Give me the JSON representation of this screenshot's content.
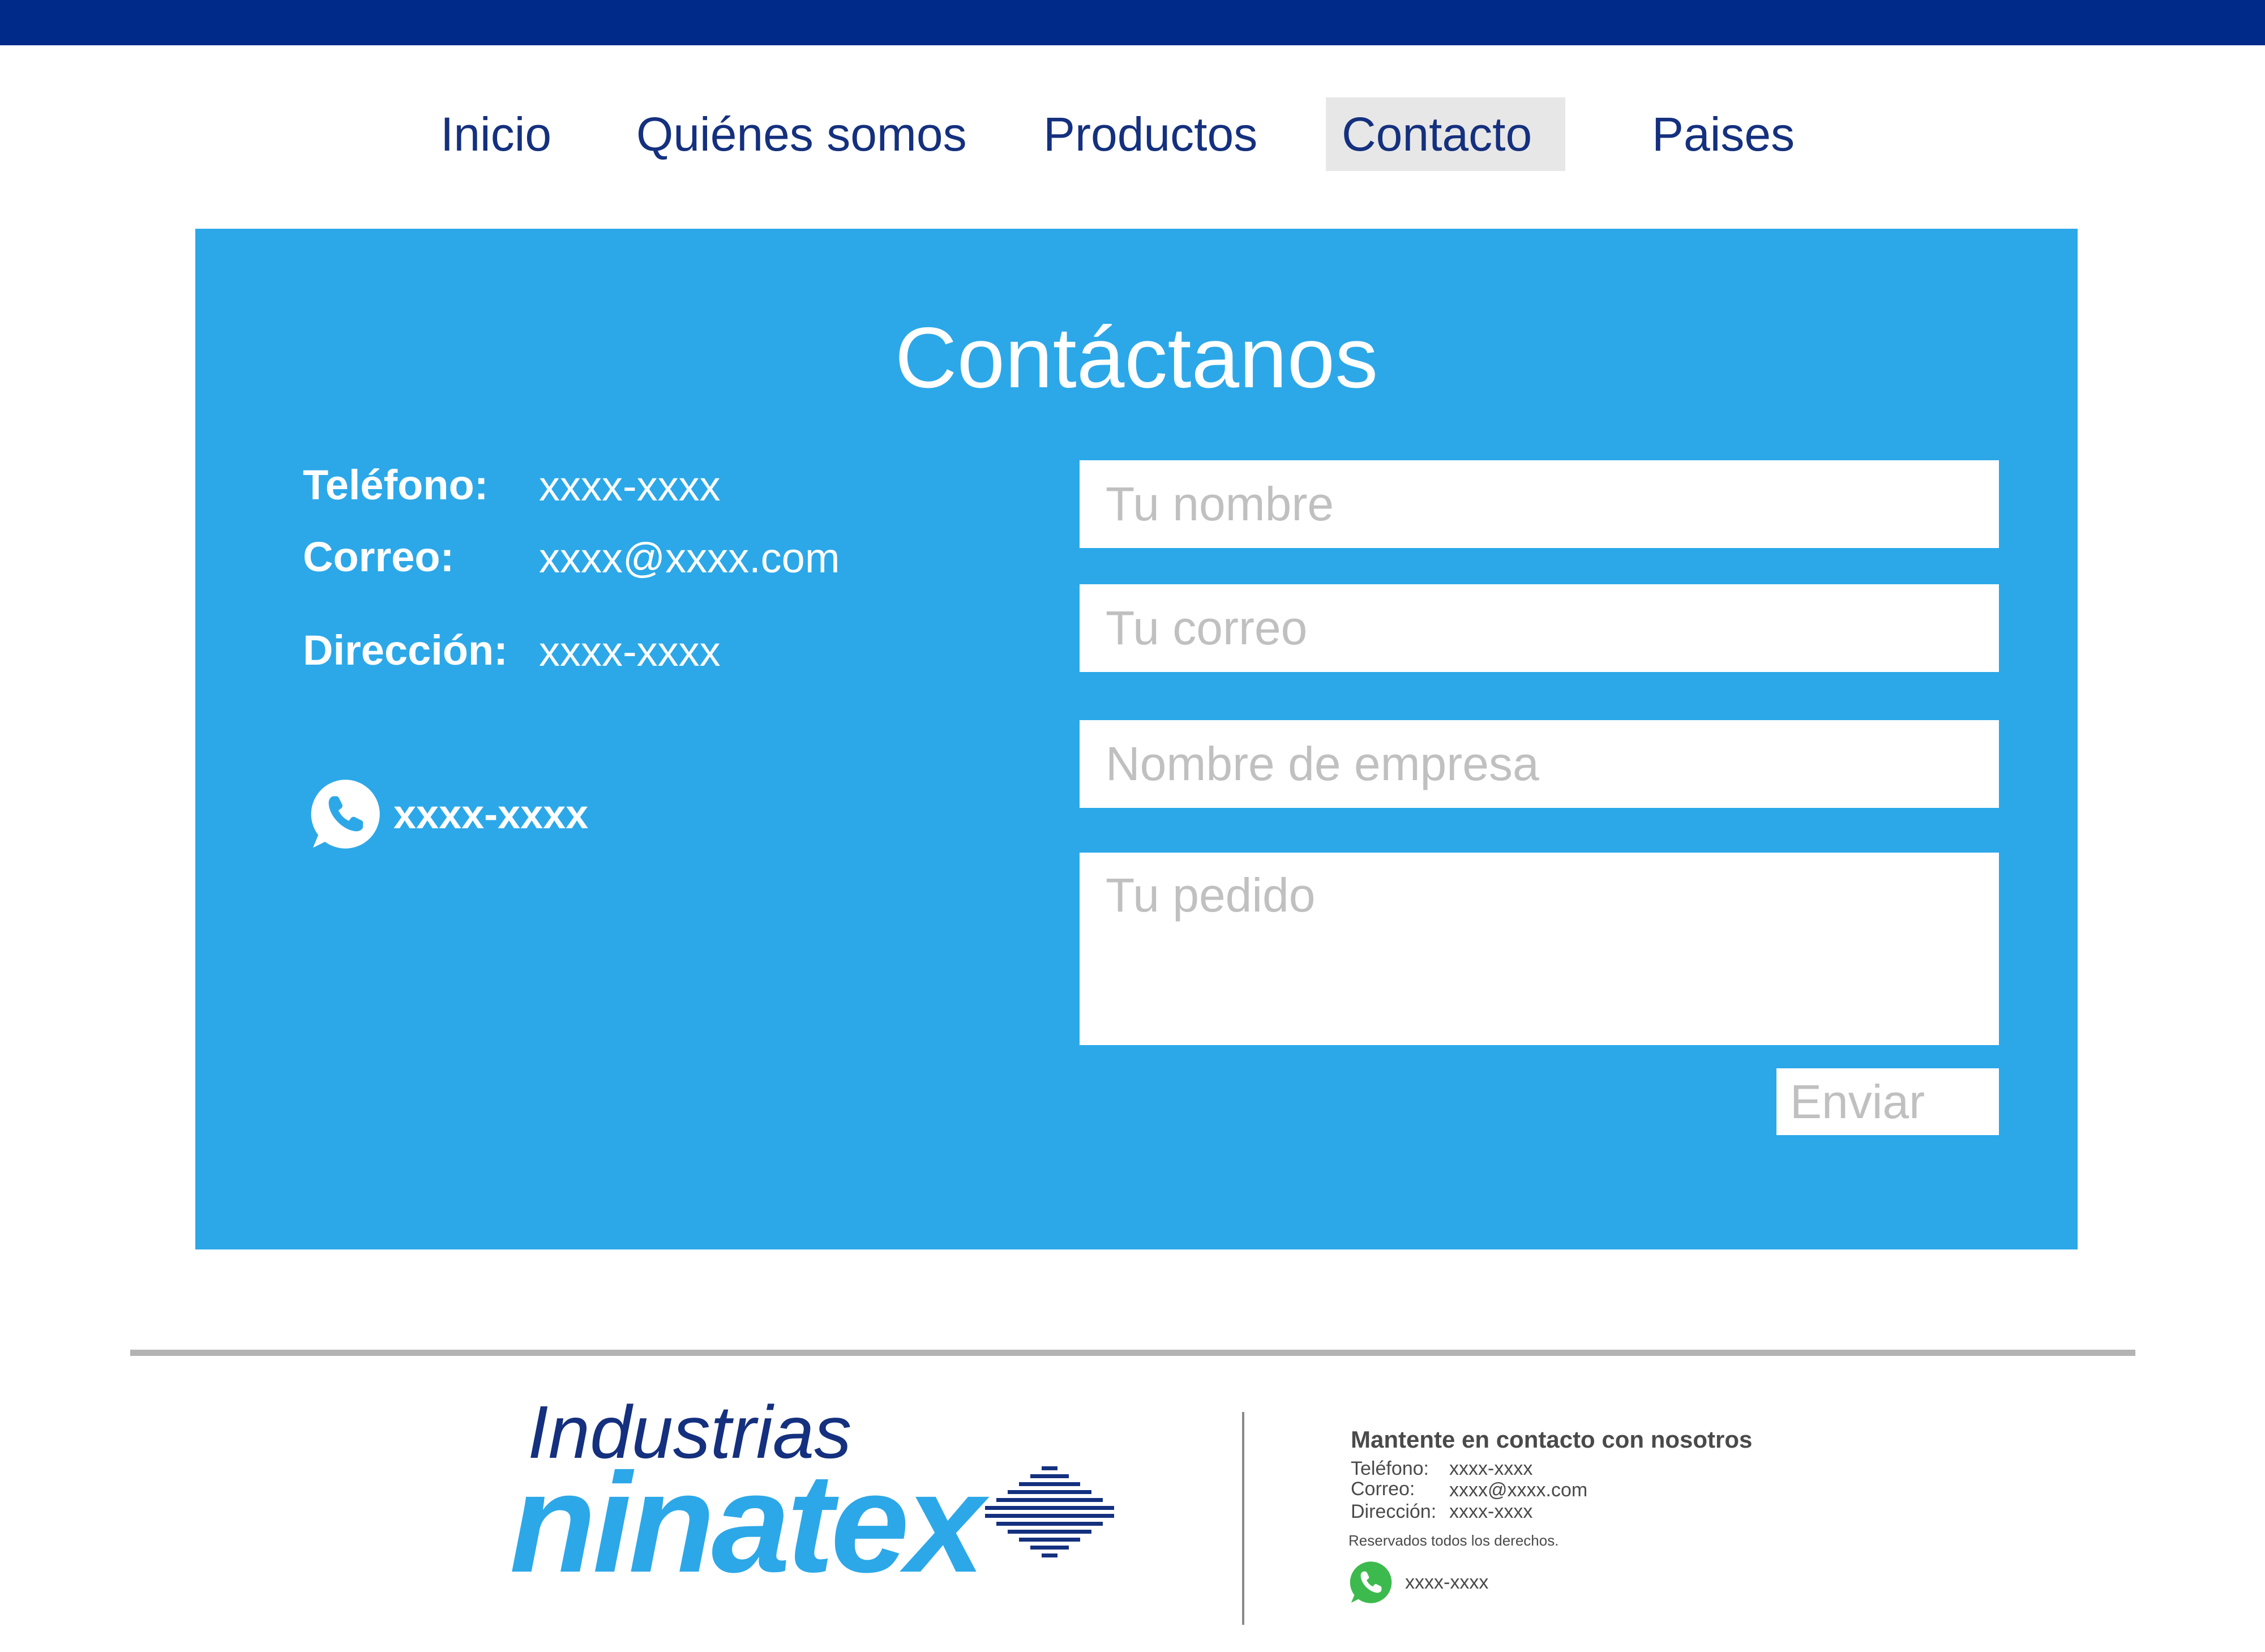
{
  "nav": {
    "items": [
      {
        "label": "Inicio"
      },
      {
        "label": "Quiénes somos"
      },
      {
        "label": "Productos"
      },
      {
        "label": "Contacto",
        "active": true
      },
      {
        "label": "Paises"
      }
    ]
  },
  "contact": {
    "title": "Contáctanos",
    "phone_label": "Teléfono:",
    "phone_value": "xxxx-xxxx",
    "email_label": "Correo:",
    "email_value": "xxxx@xxxx.com",
    "address_label": "Dirección:",
    "address_value": "xxxx-xxxx",
    "whatsapp_number": "xxxx-xxxx",
    "whatsapp_icon": "whatsapp-icon"
  },
  "form": {
    "name_placeholder": "Tu nombre",
    "email_placeholder": "Tu correo",
    "company_placeholder": "Nombre de empresa",
    "order_placeholder": "Tu pedido",
    "submit_label": "Enviar"
  },
  "footer": {
    "logo_top": "Industrias",
    "logo_main": "ninatex",
    "heading": "Mantente en contacto con nosotros",
    "phone_label": "Teléfono:",
    "phone_value": "xxxx-xxxx",
    "email_label": "Correo:",
    "email_value": "xxxx@xxxx.com",
    "address_label": "Dirección:",
    "address_value": "xxxx-xxxx",
    "rights": "Reservados todos los derechos.",
    "whatsapp_number": "xxxx-xxxx"
  },
  "colors": {
    "top_bar": "#002a8a",
    "nav_text": "#14307e",
    "panel": "#2ca8e8",
    "nav_active_bg": "#e7e7e7",
    "whatsapp_green": "#3dba4e"
  }
}
